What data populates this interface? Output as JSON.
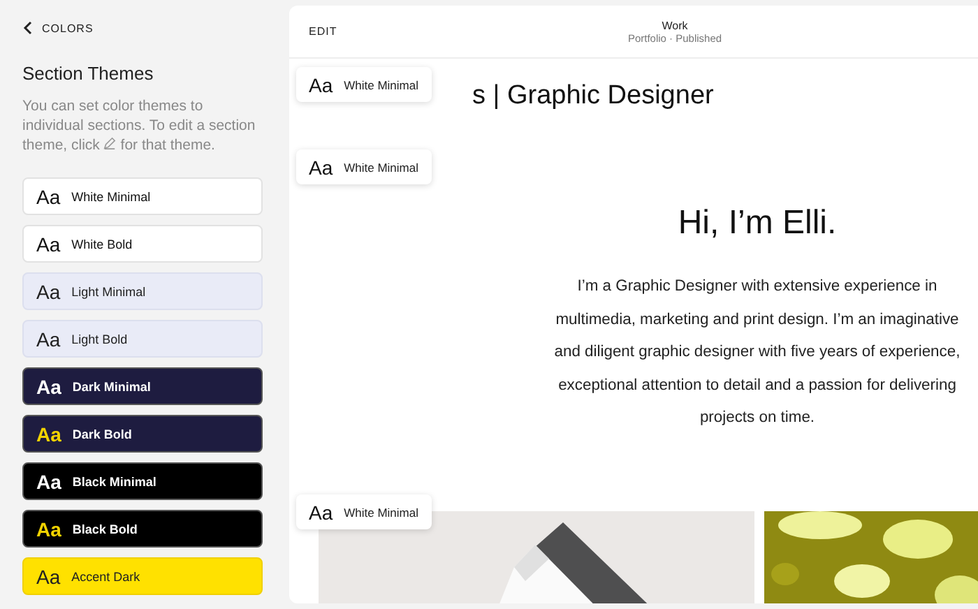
{
  "sidebar": {
    "back_label": "COLORS",
    "title": "Section Themes",
    "description_before": "You can set color themes to individual sections. To edit a section theme, click",
    "description_after": "for that theme.",
    "themes": [
      {
        "sample": "Aa",
        "label": "White Minimal",
        "kind": "white",
        "highlight": false
      },
      {
        "sample": "Aa",
        "label": "White Bold",
        "kind": "white",
        "highlight": false
      },
      {
        "sample": "Aa",
        "label": "Light Minimal",
        "kind": "light",
        "highlight": false
      },
      {
        "sample": "Aa",
        "label": "Light Bold",
        "kind": "light",
        "highlight": false
      },
      {
        "sample": "Aa",
        "label": "Dark Minimal",
        "kind": "dark",
        "highlight": false
      },
      {
        "sample": "Aa",
        "label": "Dark Bold",
        "kind": "dark",
        "highlight": true
      },
      {
        "sample": "Aa",
        "label": "Black Minimal",
        "kind": "black",
        "highlight": false
      },
      {
        "sample": "Aa",
        "label": "Black Bold",
        "kind": "black",
        "highlight": true
      },
      {
        "sample": "Aa",
        "label": "Accent Dark",
        "kind": "accent",
        "highlight": false
      }
    ]
  },
  "preview": {
    "edit_label": "EDIT",
    "page_title": "Work",
    "page_status": "Portfolio · Published",
    "heading": "s | Graphic Designer",
    "hero_title": "Hi, I’m Elli.",
    "hero_text": "I’m a Graphic Designer with extensive experience in multimedia, marketing and print design. I’m an imaginative and diligent graphic designer with five years of experience, exceptional attention to detail and a passion for delivering projects on time.",
    "section_chips": [
      {
        "sample": "Aa",
        "label": "White Minimal"
      },
      {
        "sample": "Aa",
        "label": "White Minimal"
      },
      {
        "sample": "Aa",
        "label": "White Minimal"
      }
    ]
  }
}
